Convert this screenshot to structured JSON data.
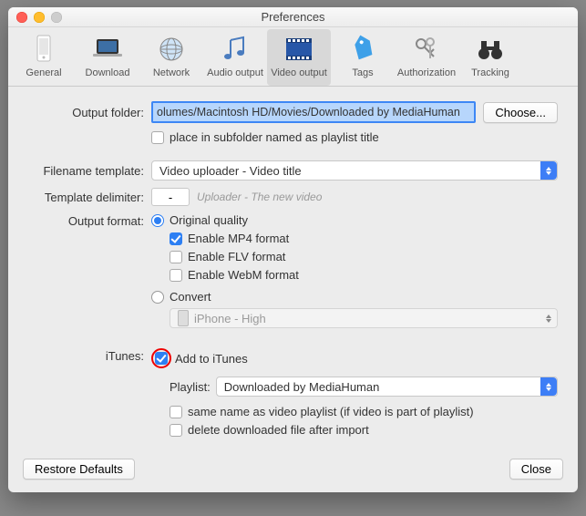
{
  "window": {
    "title": "Preferences"
  },
  "toolbar": {
    "items": [
      {
        "label": "General"
      },
      {
        "label": "Download"
      },
      {
        "label": "Network"
      },
      {
        "label": "Audio output"
      },
      {
        "label": "Video output"
      },
      {
        "label": "Tags"
      },
      {
        "label": "Authorization"
      },
      {
        "label": "Tracking"
      }
    ]
  },
  "labels": {
    "output_folder": "Output folder:",
    "filename_template": "Filename template:",
    "template_delimiter": "Template delimiter:",
    "output_format": "Output format:",
    "itunes": "iTunes:",
    "playlist": "Playlist:"
  },
  "output_folder": {
    "path": "olumes/Macintosh HD/Movies/Downloaded by MediaHuman",
    "choose": "Choose...",
    "subfolder": "place in subfolder named as playlist title"
  },
  "filename_template": {
    "value": "Video uploader - Video title"
  },
  "template_delimiter": {
    "value": "-",
    "hint": "Uploader - The new video"
  },
  "output_format": {
    "original": "Original quality",
    "mp4": "Enable MP4 format",
    "flv": "Enable FLV format",
    "webm": "Enable WebM format",
    "convert": "Convert",
    "preset": "iPhone - High"
  },
  "itunes": {
    "add": "Add to iTunes",
    "playlist_value": "Downloaded by MediaHuman",
    "same_name": "same name as video playlist (if video is part of playlist)",
    "delete_after": "delete downloaded file after import"
  },
  "footer": {
    "restore": "Restore Defaults",
    "close": "Close"
  }
}
